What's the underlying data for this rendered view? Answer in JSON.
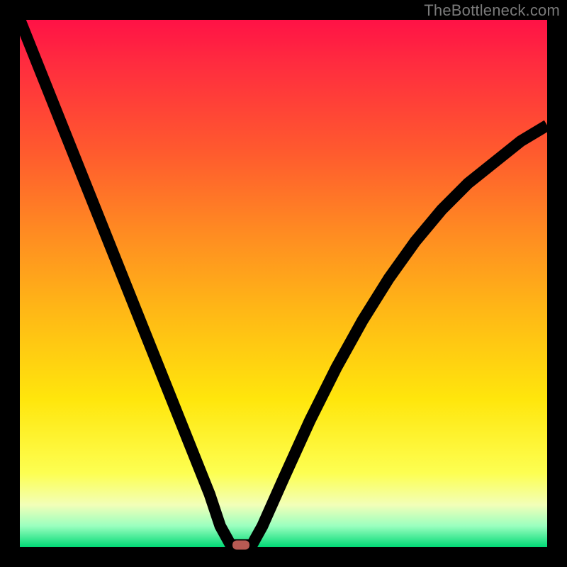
{
  "watermark": "TheBottleneck.com",
  "chart_data": {
    "type": "line",
    "title": "",
    "xlabel": "",
    "ylabel": "",
    "xlim": [
      0,
      100
    ],
    "ylim": [
      0,
      100
    ],
    "grid": false,
    "legend": false,
    "curve_points": [
      {
        "x": 0,
        "y": 100
      },
      {
        "x": 4,
        "y": 90
      },
      {
        "x": 8,
        "y": 80
      },
      {
        "x": 12,
        "y": 70
      },
      {
        "x": 16,
        "y": 60
      },
      {
        "x": 20,
        "y": 50
      },
      {
        "x": 24,
        "y": 40
      },
      {
        "x": 28,
        "y": 30
      },
      {
        "x": 32,
        "y": 20
      },
      {
        "x": 36,
        "y": 10
      },
      {
        "x": 38,
        "y": 4
      },
      {
        "x": 40,
        "y": 0.4
      },
      {
        "x": 44,
        "y": 0.4
      },
      {
        "x": 46,
        "y": 4
      },
      {
        "x": 50,
        "y": 13
      },
      {
        "x": 55,
        "y": 24
      },
      {
        "x": 60,
        "y": 34
      },
      {
        "x": 65,
        "y": 43
      },
      {
        "x": 70,
        "y": 51
      },
      {
        "x": 75,
        "y": 58
      },
      {
        "x": 80,
        "y": 64
      },
      {
        "x": 85,
        "y": 69
      },
      {
        "x": 90,
        "y": 73
      },
      {
        "x": 95,
        "y": 77
      },
      {
        "x": 100,
        "y": 80
      }
    ],
    "marker": {
      "x": 42,
      "y": 0.4,
      "color": "#b85a53"
    }
  }
}
